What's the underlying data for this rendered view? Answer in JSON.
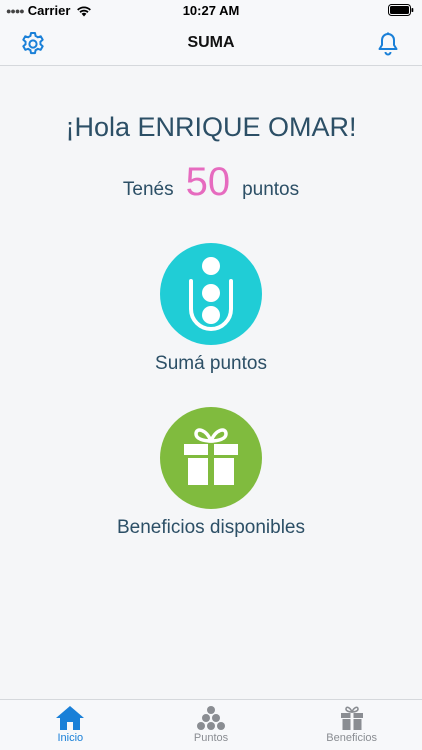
{
  "status_bar": {
    "carrier": "Carrier",
    "time": "10:27 AM"
  },
  "nav": {
    "title": "SUMA"
  },
  "greeting": "¡Hola ENRIQUE OMAR!",
  "points": {
    "prefix": "Tenés",
    "value": "50",
    "suffix": "puntos"
  },
  "actions": [
    {
      "label": "Sumá puntos",
      "icon": "suma-logo-icon"
    },
    {
      "label": "Beneficios disponibles",
      "icon": "gift-icon"
    }
  ],
  "tabs": [
    {
      "label": "Inicio",
      "icon": "home-icon",
      "active": true
    },
    {
      "label": "Puntos",
      "icon": "points-dots-icon",
      "active": false
    },
    {
      "label": "Beneficios",
      "icon": "gift-icon",
      "active": false
    }
  ],
  "colors": {
    "accent": "#1a80d8",
    "heading_text": "#2c4f66",
    "points_pink": "#e66bbf",
    "suma_teal": "#20cdd6",
    "beneficios_green": "#80bb3e"
  }
}
